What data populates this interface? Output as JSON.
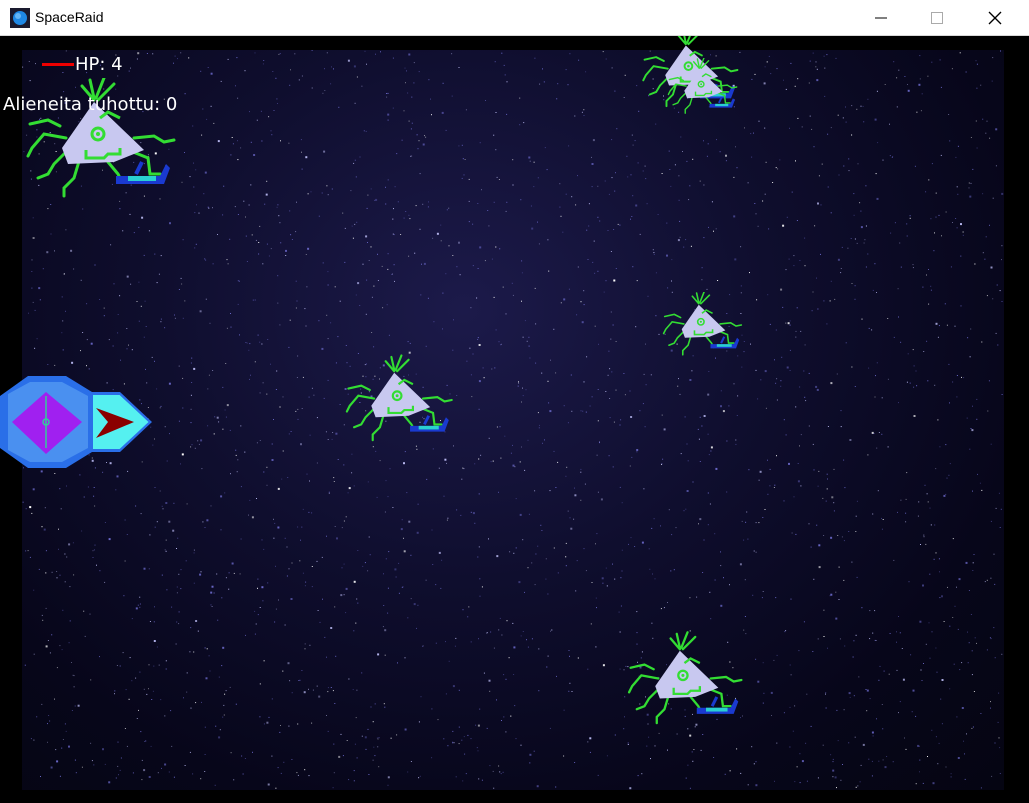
{
  "window": {
    "title": "SpaceRaid",
    "controls": [
      "minimize",
      "maximize",
      "close"
    ]
  },
  "hud": {
    "hp_label": "HP: 4",
    "hp_value": 4,
    "kills_label": "Alieneita tuhottu: 0",
    "kills_value": 0
  },
  "colors": {
    "background": "#000000",
    "alien_body": "#c8c8f0",
    "alien_tentacles": "#33dd33",
    "player_hull": "#2a6fe8",
    "player_cockpit": "#a020f0",
    "player_nose": "#55f0f0",
    "hp_bar": "#ee0000"
  },
  "entities": {
    "player": {
      "type": "player-ship",
      "icon": "spaceship-icon"
    },
    "aliens": [
      {
        "type": "alien-on-hoverboard",
        "icon": "alien-icon"
      },
      {
        "type": "alien-on-hoverboard",
        "icon": "alien-icon"
      },
      {
        "type": "alien-on-hoverboard",
        "icon": "alien-icon"
      },
      {
        "type": "alien-on-hoverboard",
        "icon": "alien-icon"
      },
      {
        "type": "alien-on-hoverboard",
        "icon": "alien-icon"
      },
      {
        "type": "alien-on-hoverboard",
        "icon": "alien-icon"
      }
    ]
  }
}
